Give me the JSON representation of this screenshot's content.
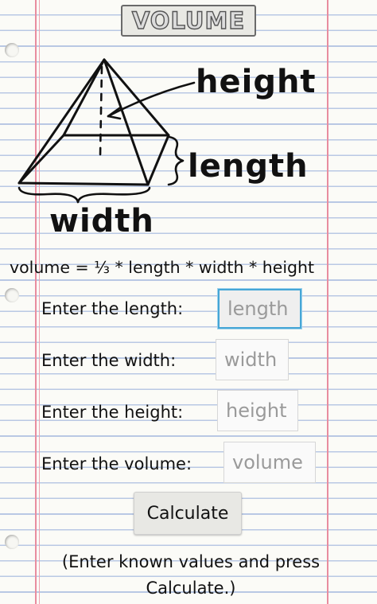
{
  "title": "VOLUME",
  "diagram": {
    "height_label": "height",
    "length_label": "length",
    "width_label": "width"
  },
  "formula": "volume = ⅓ * length * width * height",
  "fields": {
    "length": {
      "label": "Enter the length:",
      "placeholder": "length",
      "value": ""
    },
    "width": {
      "label": "Enter the width:",
      "placeholder": "width",
      "value": ""
    },
    "height": {
      "label": "Enter the height:",
      "placeholder": "height",
      "value": ""
    },
    "volume": {
      "label": "Enter the volume:",
      "placeholder": "volume",
      "value": ""
    }
  },
  "calculate_label": "Calculate",
  "hint": "(Enter known values and press Calculate.)",
  "colors": {
    "accent_focus": "#45a6d6",
    "margin_line": "#e88d9f",
    "rule_line": "#b9c8e4"
  }
}
